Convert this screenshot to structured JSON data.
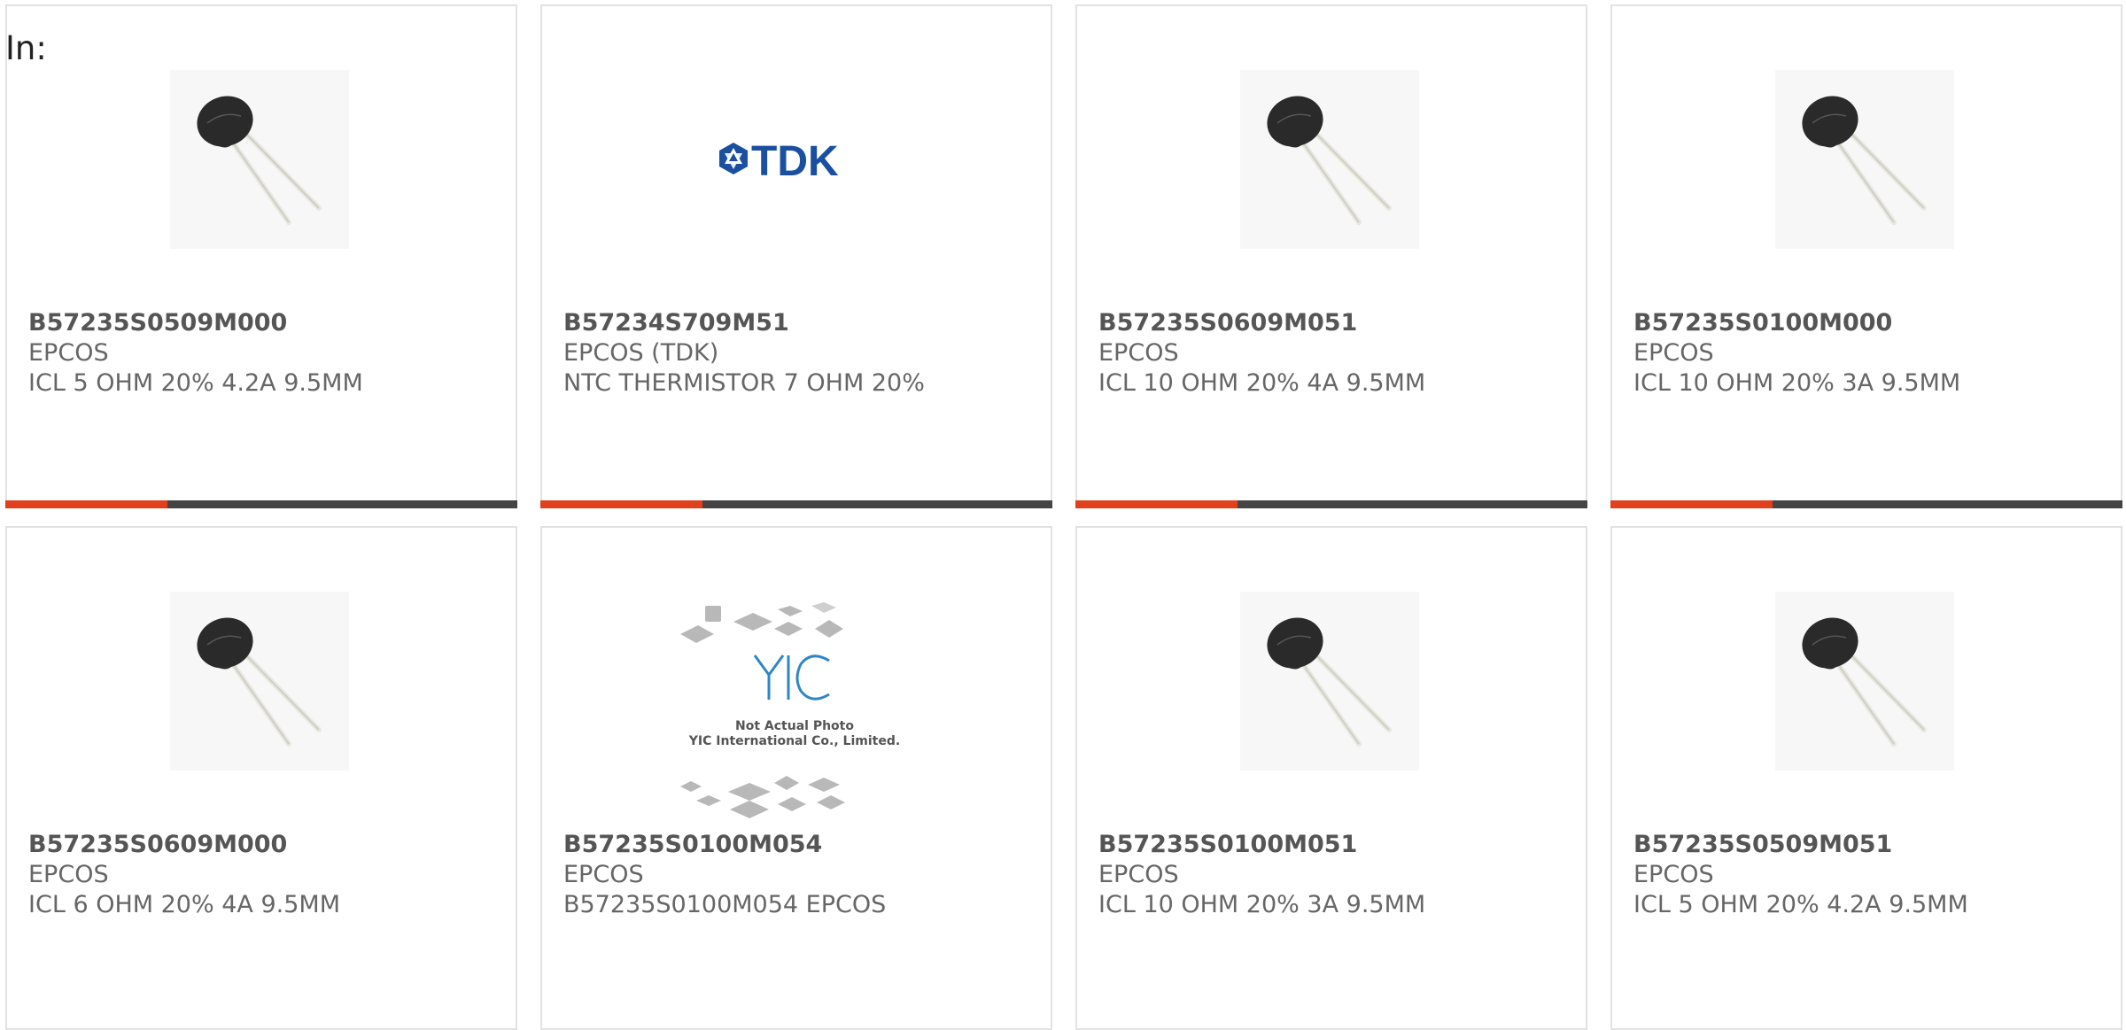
{
  "page": {
    "label": "In:"
  },
  "products": [
    {
      "part": "B57235S0509M000",
      "maker": "EPCOS",
      "desc": "ICL 5 OHM 20% 4.2A 9.5MM",
      "image": "thermistor-photo",
      "bar_fill": 0.31
    },
    {
      "part": "B57234S709M51",
      "maker": "EPCOS (TDK)",
      "desc": "NTC THERMISTOR 7 OHM 20%",
      "image": "tdk-logo",
      "logo_text": "TDK",
      "bar_fill": 0.31
    },
    {
      "part": "B57235S0609M051",
      "maker": "EPCOS",
      "desc": "ICL 10 OHM 20% 4A 9.5MM",
      "image": "thermistor-photo",
      "bar_fill": 0.31
    },
    {
      "part": "B57235S0100M000",
      "maker": "EPCOS",
      "desc": "ICL 10 OHM 20% 3A 9.5MM",
      "image": "thermistor-photo",
      "bar_fill": 0.31
    },
    {
      "part": "B57235S0609M000",
      "maker": "EPCOS",
      "desc": "ICL 6 OHM 20% 4A 9.5MM",
      "image": "thermistor-photo"
    },
    {
      "part": "B57235S0100M054",
      "maker": "EPCOS",
      "desc": "B57235S0100M054 EPCOS",
      "image": "yic-placeholder",
      "placeholder_line1": "Not Actual Photo",
      "placeholder_line2": "YIC International Co., Limited."
    },
    {
      "part": "B57235S0100M051",
      "maker": "EPCOS",
      "desc": "ICL 10 OHM 20% 3A 9.5MM",
      "image": "thermistor-photo"
    },
    {
      "part": "B57235S0509M051",
      "maker": "EPCOS",
      "desc": "ICL 5 OHM 20% 4.2A 9.5MM",
      "image": "thermistor-photo"
    }
  ],
  "colors": {
    "accent": "#e0401c",
    "bar_track": "#444444",
    "border": "#e2e2e2",
    "tdk_blue": "#1b4fa0"
  }
}
